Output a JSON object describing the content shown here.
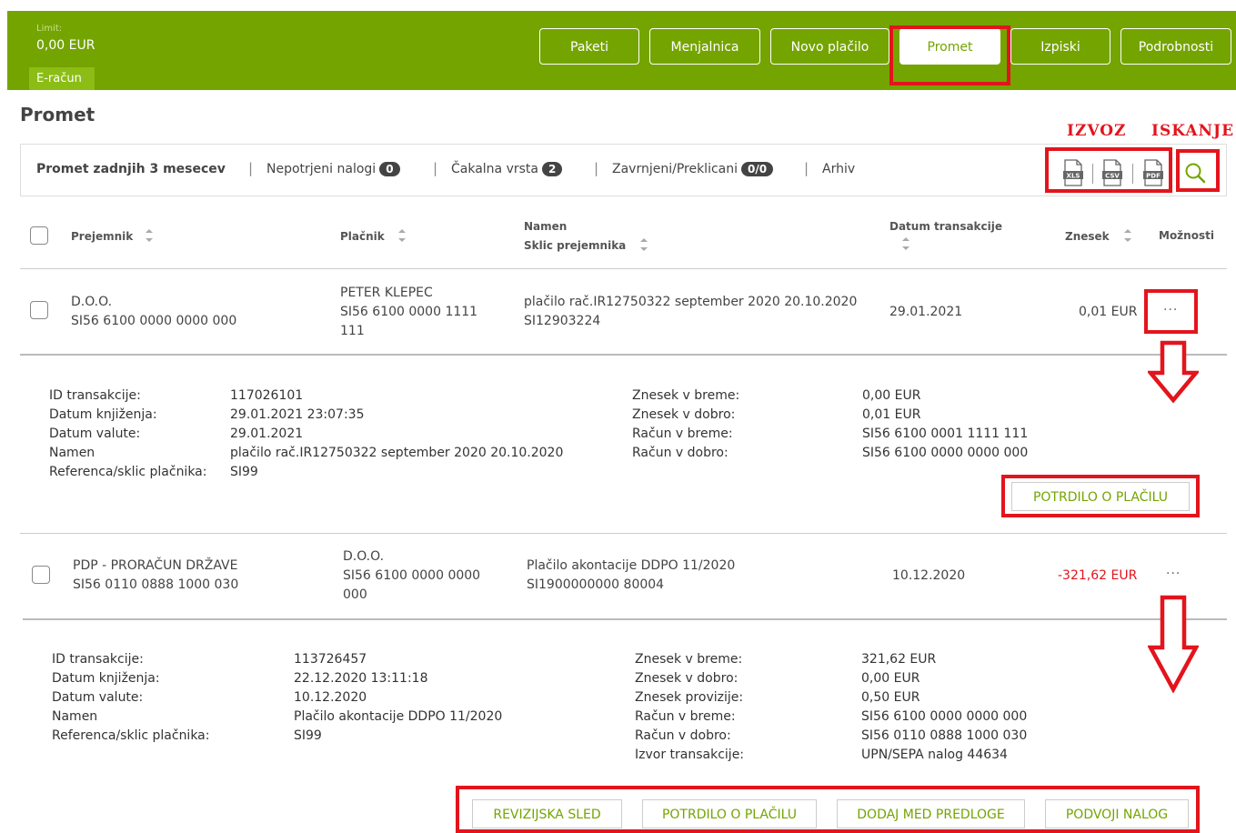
{
  "header": {
    "limit_label": "Limit:",
    "limit_value": "0,00 EUR",
    "account_tab": "E-račun",
    "nav": [
      "Paketi",
      "Menjalnica",
      "Novo plačilo",
      "Promet",
      "Izpiski",
      "Podrobnosti"
    ],
    "active_nav": "Promet"
  },
  "page_title": "Promet",
  "annotations": {
    "export_label": "IZVOZ",
    "search_label": "ISKANJE"
  },
  "filters": {
    "recent": "Promet zadnjih 3 mesecev",
    "unconfirmed": "Nepotrjeni nalogi",
    "unconfirmed_count": "0",
    "queue": "Čakalna vrsta",
    "queue_count": "2",
    "rejected": "Zavrnjeni/Preklicani",
    "rejected_count": "0/0",
    "archive": "Arhiv"
  },
  "export": {
    "xls": "XLS",
    "csv": "CSV",
    "pdf": "PDF"
  },
  "columns": {
    "recipient": "Prejemnik",
    "payer": "Plačnik",
    "purpose": "Namen",
    "reference": "Sklic prejemnika",
    "date": "Datum transakcije",
    "amount": "Znesek",
    "options": "Možnosti"
  },
  "transactions": [
    {
      "recipient_name": "D.O.O.",
      "recipient_account": "SI56 6100 0000 0000 000",
      "payer_line1": "PETER KLEPEC",
      "payer_line2": "SI56 6100 0000 1111",
      "payer_line3": "111",
      "purpose": "plačilo rač.IR12750322 september 2020 20.10.2020",
      "reference": "SI12903224",
      "date": "29.01.2021",
      "amount": "0,01 EUR",
      "options": "···",
      "details_left": [
        {
          "label": "ID transakcije:",
          "value": "117026101"
        },
        {
          "label": "Datum knjiženja:",
          "value": "29.01.2021 23:07:35"
        },
        {
          "label": "Datum valute:",
          "value": "29.01.2021"
        },
        {
          "label": "Namen",
          "value": "plačilo rač.IR12750322 september 2020 20.10.2020"
        },
        {
          "label": "Referenca/sklic plačnika:",
          "value": "SI99"
        }
      ],
      "details_right": [
        {
          "label": "Znesek v breme:",
          "value": "0,00 EUR"
        },
        {
          "label": "Znesek v dobro:",
          "value": "0,01 EUR"
        },
        {
          "label": "Račun v breme:",
          "value": "SI56 6100 0001 1111 111"
        },
        {
          "label": "Račun v dobro:",
          "value": "SI56 6100 0000 0000 000"
        }
      ],
      "actions": [
        "POTRDILO O PLAČILU"
      ]
    },
    {
      "recipient_name": "PDP - PRORAČUN DRŽAVE",
      "recipient_account": "SI56 0110 0888 1000 030",
      "payer_line1": "D.O.O.",
      "payer_line2": "SI56 6100 0000 0000",
      "payer_line3": "000",
      "purpose": "Plačilo akontacije DDPO 11/2020",
      "reference": "SI1900000000 80004",
      "date": "10.12.2020",
      "amount": "-321,62 EUR",
      "options": "···",
      "details_left": [
        {
          "label": "ID transakcije:",
          "value": "113726457"
        },
        {
          "label": "Datum knjiženja:",
          "value": "22.12.2020 13:11:18"
        },
        {
          "label": "Datum valute:",
          "value": "10.12.2020"
        },
        {
          "label": "Namen",
          "value": "Plačilo akontacije DDPO 11/2020"
        },
        {
          "label": "Referenca/sklic plačnika:",
          "value": "SI99"
        }
      ],
      "details_right": [
        {
          "label": "Znesek v breme:",
          "value": "321,62 EUR"
        },
        {
          "label": "Znesek v dobro:",
          "value": "0,00 EUR"
        },
        {
          "label": "Znesek provizije:",
          "value": "0,50 EUR"
        },
        {
          "label": "Račun v breme:",
          "value": "SI56 6100 0000 0000 000"
        },
        {
          "label": "Račun v dobro:",
          "value": "SI56 0110 0888 1000 030"
        },
        {
          "label": "Izvor transakcije:",
          "value": "UPN/SEPA nalog 44634"
        }
      ],
      "actions": [
        "REVIZIJSKA SLED",
        "POTRDILO O PLAČILU",
        "DODAJ MED PREDLOGE",
        "PODVOJI NALOG"
      ]
    }
  ],
  "colors": {
    "brand": "#74a400",
    "highlight": "#e3141c",
    "negative": "#e3141c"
  }
}
